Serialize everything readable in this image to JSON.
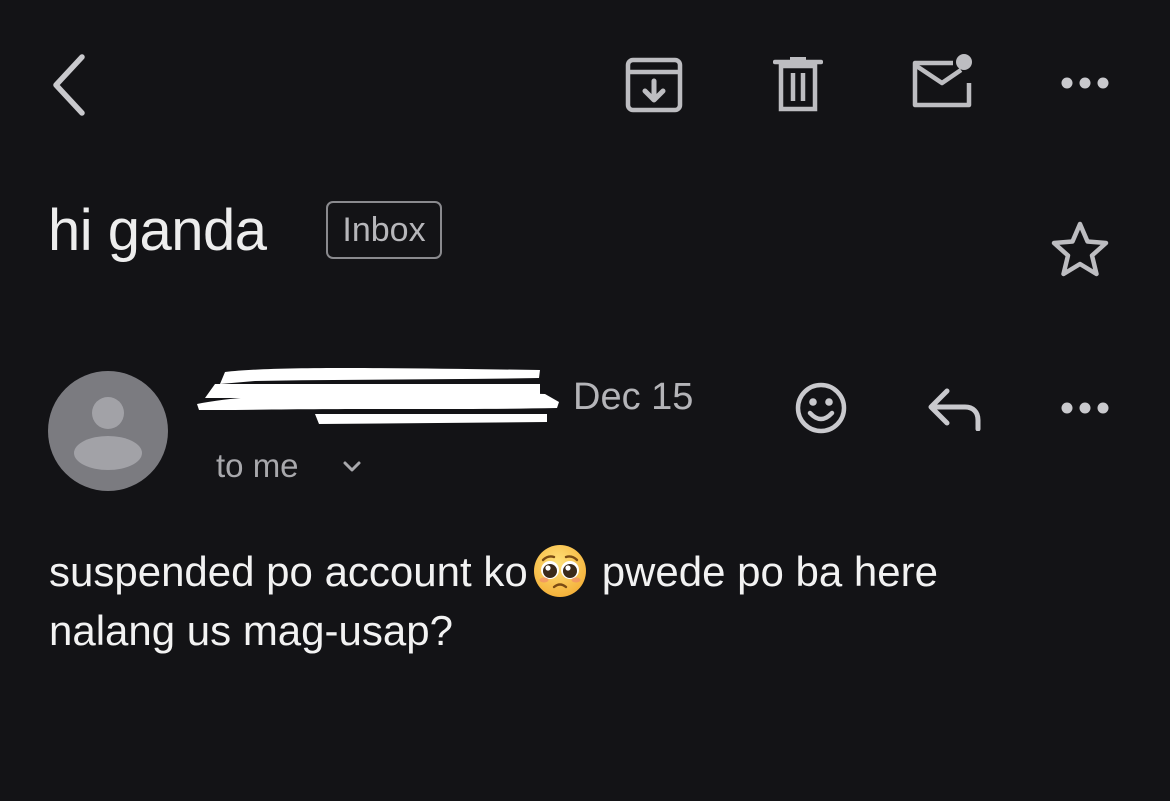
{
  "toolbar": {
    "back_icon": "chevron-left-icon",
    "archive_icon": "archive-icon",
    "delete_icon": "trash-icon",
    "mark_unread_icon": "mail-unread-icon",
    "more_icon": "more-horizontal-icon"
  },
  "email": {
    "subject": "hi ganda",
    "label": "Inbox",
    "starred": false,
    "sender": {
      "name_redacted": true,
      "date": "Dec 15",
      "recipient": "to me"
    },
    "body": {
      "before_emoji": "suspended po account ko",
      "emoji": "pleading-face-emoji",
      "after_emoji": "pwede po ba here",
      "line2": "nalang us mag-usap?"
    }
  },
  "colors": {
    "background": "#131316",
    "text": "#e8e8ea",
    "muted": "#b4b4b8",
    "icon": "#bdbdc1",
    "avatar": "#7b7b80"
  }
}
